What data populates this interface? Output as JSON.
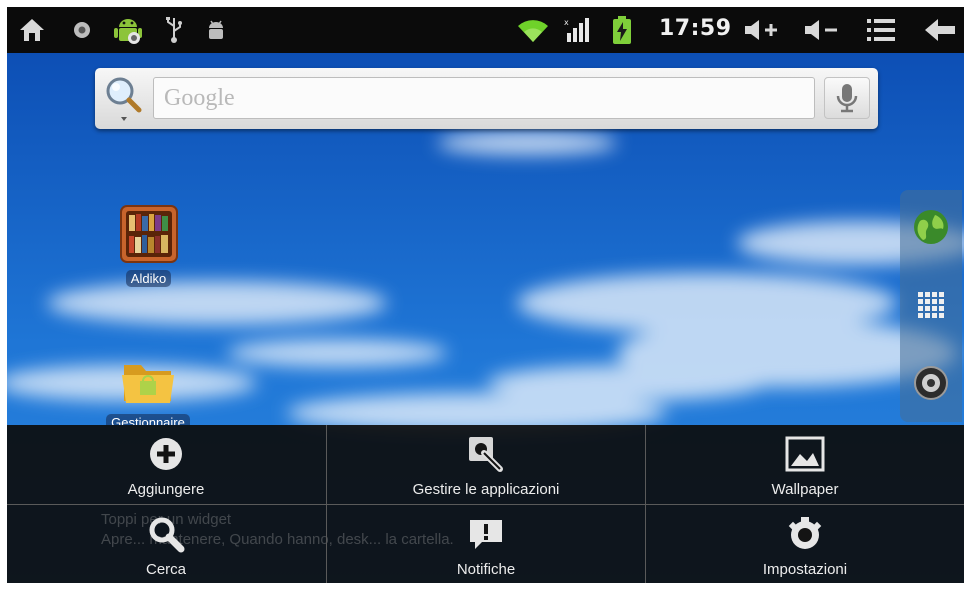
{
  "status_bar": {
    "left_icons": [
      "home-icon",
      "record-icon",
      "android-debug-icon",
      "usb-icon",
      "android-icon"
    ],
    "right_icons": [
      "wifi-icon",
      "signal-icon",
      "battery-charging-icon"
    ],
    "time": "17:59",
    "buttons": [
      "volume-up-icon",
      "volume-down-icon",
      "menu-icon",
      "back-icon"
    ]
  },
  "search": {
    "placeholder": "Google"
  },
  "desktop": {
    "apps": [
      {
        "label": "Aldiko",
        "icon": "bookshelf-icon"
      },
      {
        "label": "Gestionnaire",
        "icon": "folder-icon"
      }
    ]
  },
  "dock": {
    "buttons": [
      "browser-icon",
      "app-drawer-icon",
      "camera-icon"
    ]
  },
  "menu": {
    "items": [
      {
        "label": "Aggiungere",
        "icon": "add-icon"
      },
      {
        "label": "Gestire le applicazioni",
        "icon": "manage-apps-icon"
      },
      {
        "label": "Wallpaper",
        "icon": "wallpaper-icon"
      },
      {
        "label": "Cerca",
        "icon": "search-icon"
      },
      {
        "label": "Notifiche",
        "icon": "notifications-icon"
      },
      {
        "label": "Impostazioni",
        "icon": "settings-icon"
      }
    ]
  },
  "background_hint": {
    "title": "Toppi per un widget",
    "text": "Apre... mantenere, Quando hanno, desk... la cartella."
  },
  "colors": {
    "sky": "#1d6fcf",
    "status_bar": "#0b0b0b",
    "menu_bg": "#0c0c0c",
    "wifi_green": "#6fd22a"
  }
}
